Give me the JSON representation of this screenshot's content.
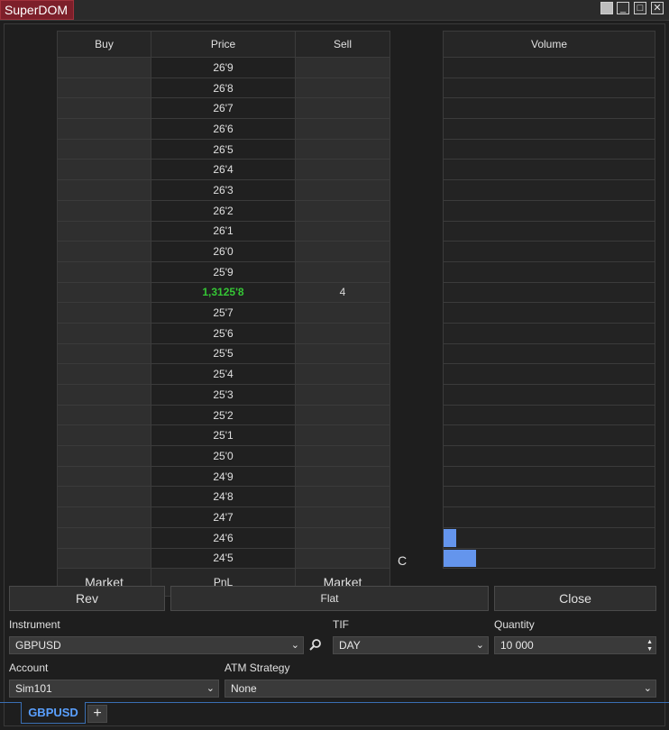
{
  "window": {
    "title": "SuperDOM"
  },
  "ladder": {
    "headers": {
      "buy": "Buy",
      "price": "Price",
      "sell": "Sell",
      "volume": "Volume"
    },
    "rows": [
      {
        "price": "26'9",
        "sell": "",
        "volume": 0
      },
      {
        "price": "26'8",
        "sell": "",
        "volume": 0
      },
      {
        "price": "26'7",
        "sell": "",
        "volume": 0
      },
      {
        "price": "26'6",
        "sell": "",
        "volume": 0
      },
      {
        "price": "26'5",
        "sell": "",
        "volume": 0
      },
      {
        "price": "26'4",
        "sell": "",
        "volume": 0
      },
      {
        "price": "26'3",
        "sell": "",
        "volume": 0
      },
      {
        "price": "26'2",
        "sell": "",
        "volume": 0
      },
      {
        "price": "26'1",
        "sell": "",
        "volume": 0
      },
      {
        "price": "26'0",
        "sell": "",
        "volume": 0
      },
      {
        "price": "25'9",
        "sell": "",
        "volume": 0
      },
      {
        "price": "1,3125'8",
        "sell": "4",
        "volume": 0,
        "last": true
      },
      {
        "price": "25'7",
        "sell": "",
        "volume": 0
      },
      {
        "price": "25'6",
        "sell": "",
        "volume": 0
      },
      {
        "price": "25'5",
        "sell": "",
        "volume": 0
      },
      {
        "price": "25'4",
        "sell": "",
        "volume": 0
      },
      {
        "price": "25'3",
        "sell": "",
        "volume": 0
      },
      {
        "price": "25'2",
        "sell": "",
        "volume": 0
      },
      {
        "price": "25'1",
        "sell": "",
        "volume": 0
      },
      {
        "price": "25'0",
        "sell": "",
        "volume": 0
      },
      {
        "price": "24'9",
        "sell": "",
        "volume": 0
      },
      {
        "price": "24'8",
        "sell": "",
        "volume": 0
      },
      {
        "price": "24'7",
        "sell": "",
        "volume": 0
      },
      {
        "price": "24'6",
        "sell": "",
        "volume": 0.4
      },
      {
        "price": "24'5",
        "sell": "",
        "volume": 1.0
      }
    ],
    "footer": {
      "buy_market": "Market",
      "pnl": "PnL",
      "sell_market": "Market",
      "c_label": "C"
    },
    "colors": {
      "last_price": "#35c535",
      "volume_bar": "#6495ed"
    }
  },
  "actions": {
    "rev": "Rev",
    "flat": "Flat",
    "close": "Close"
  },
  "order": {
    "instrument_label": "Instrument",
    "instrument_value": "GBPUSD",
    "tif_label": "TIF",
    "tif_value": "DAY",
    "quantity_label": "Quantity",
    "quantity_value": "10 000",
    "account_label": "Account",
    "account_value": "Sim101",
    "atm_label": "ATM Strategy",
    "atm_value": "None"
  },
  "tabs": {
    "active": "GBPUSD",
    "add": "+"
  }
}
